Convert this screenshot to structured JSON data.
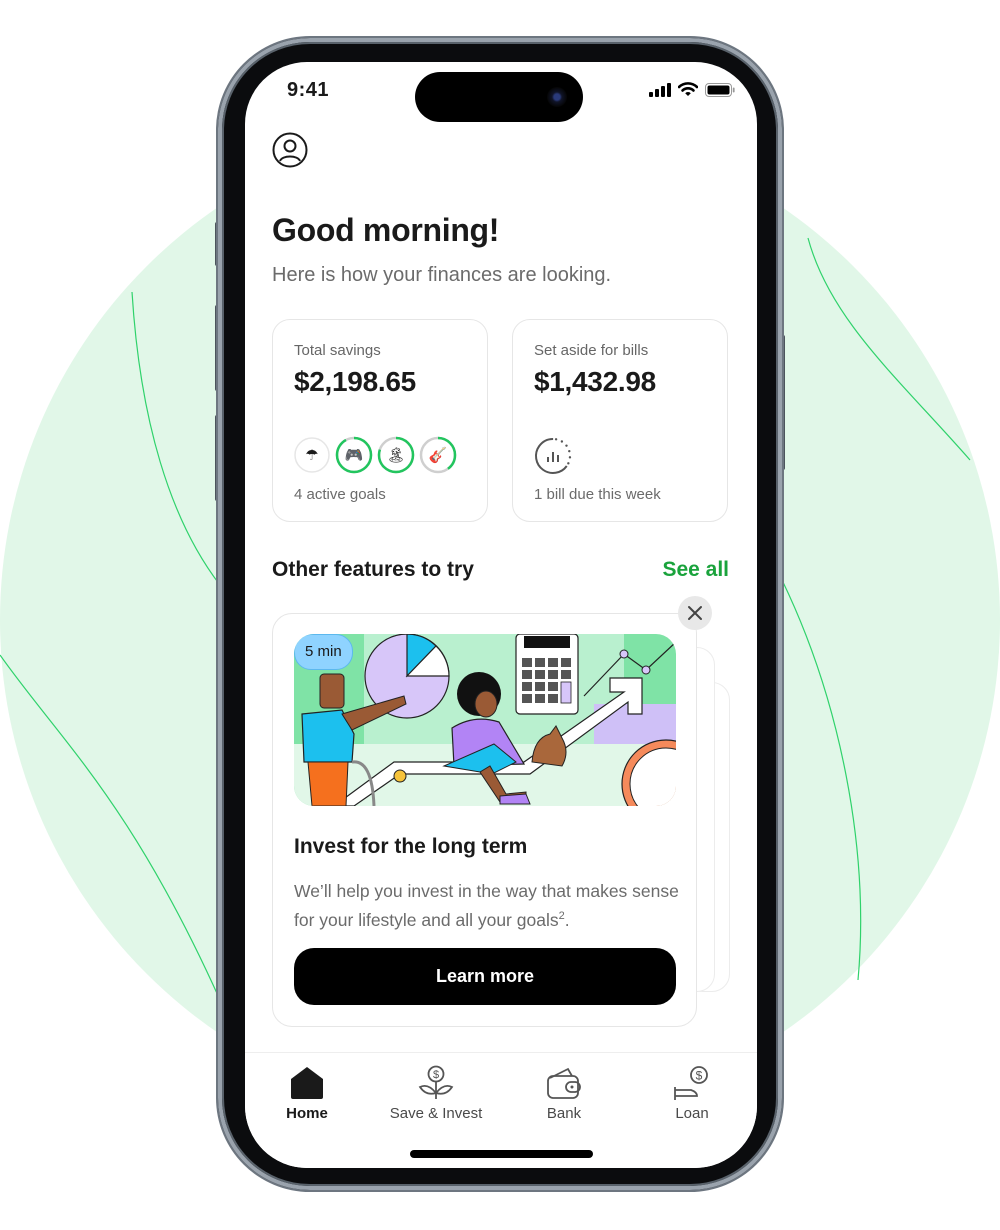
{
  "status_bar": {
    "time": "9:41"
  },
  "header": {
    "greeting": "Good morning!",
    "subtitle": "Here is how your finances are looking."
  },
  "cards": {
    "savings": {
      "label": "Total savings",
      "amount": "$2,198.65",
      "footer": "4 active goals",
      "goals": [
        {
          "icon": "umbrella-icon",
          "emoji": "☂",
          "progress": 0.0
        },
        {
          "icon": "game-controller-icon",
          "emoji": "🎮",
          "progress": 0.92
        },
        {
          "icon": "island-icon",
          "emoji": "🏝",
          "progress": 0.8
        },
        {
          "icon": "guitar-icon",
          "emoji": "🎸",
          "progress": 0.4
        }
      ]
    },
    "bills": {
      "label": "Set aside for bills",
      "amount": "$1,432.98",
      "footer": "1 bill due this week",
      "progress": 0.65
    }
  },
  "features": {
    "section_title": "Other features to try",
    "see_all_label": "See all",
    "card": {
      "duration_badge": "5 min",
      "title": "Invest for the long term",
      "description": "We’ll help you invest in the way that makes sense for your lifestyle and all your goals",
      "footnote": "2",
      "description_end": ".",
      "button_label": "Learn more"
    }
  },
  "tabbar": {
    "items": [
      {
        "label": "Home",
        "icon": "home-icon",
        "active": true
      },
      {
        "label": "Save & Invest",
        "icon": "money-plant-icon",
        "active": false
      },
      {
        "label": "Bank",
        "icon": "wallet-icon",
        "active": false
      },
      {
        "label": "Loan",
        "icon": "hand-dollar-icon",
        "active": false
      }
    ]
  },
  "colors": {
    "accent_green": "#1aa33c",
    "progress_green": "#22c55e",
    "background_tint": "#e1f7e8"
  }
}
